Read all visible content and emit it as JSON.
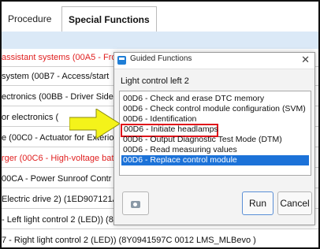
{
  "tabs": [
    {
      "label": "Procedure"
    },
    {
      "label": "Special Functions"
    }
  ],
  "background_rows": [
    {
      "text": "assistant systems (00A5 - Fro",
      "red": true
    },
    {
      "text": " system (00B7 - Access/start",
      "red": false
    },
    {
      "text": "ectronics (00BB - Driver Side",
      "red": false
    },
    {
      "text": "or electronics (",
      "red": false
    },
    {
      "text": "e (00C0 - Actuator for Exterio",
      "red": false
    },
    {
      "text": "rger (00C6 - High-voltage bat",
      "red": true
    },
    {
      "text": "00CA - Power Sunroof Contr",
      "red": false
    },
    {
      "text": "Electric drive 2) (1ED907121A",
      "red": false
    },
    {
      "text": "- Left light control 2 (LED)) (8Y0941597C   0012  LMS_MLBevo  )",
      "red": false
    },
    {
      "text": "7 - Right light control 2 (LED)) (8Y0941597C   0012  LMS_MLBevo  )",
      "red": false
    }
  ],
  "dialog": {
    "title": "Guided Functions",
    "close_glyph": "✕",
    "heading": "Light control left 2",
    "items": [
      {
        "label": "00D6 - Check and erase DTC memory",
        "selected": false,
        "highlighted": false
      },
      {
        "label": "00D6 - Check control module configuration (SVM)",
        "selected": false,
        "highlighted": false
      },
      {
        "label": "00D6 - Identification",
        "selected": false,
        "highlighted": false
      },
      {
        "label": "00D6 - Initiate headlamps",
        "selected": false,
        "highlighted": true
      },
      {
        "label": "00D6 - Output Diagnostic Test Mode (DTM)",
        "selected": false,
        "highlighted": false
      },
      {
        "label": "00D6 - Read measuring values",
        "selected": false,
        "highlighted": false
      },
      {
        "label": "00D6 - Replace control module",
        "selected": true,
        "highlighted": false
      }
    ],
    "run_label": "Run",
    "cancel_label": "Cancel",
    "icon_button_icon": "camera-icon"
  },
  "colors": {
    "accent_blue": "#1c72d8",
    "highlight_red": "#e0131a",
    "arrow_yellow": "#f4f31a",
    "warning_text_red": "#e02020",
    "subbar_blue": "#dbe9f7"
  }
}
